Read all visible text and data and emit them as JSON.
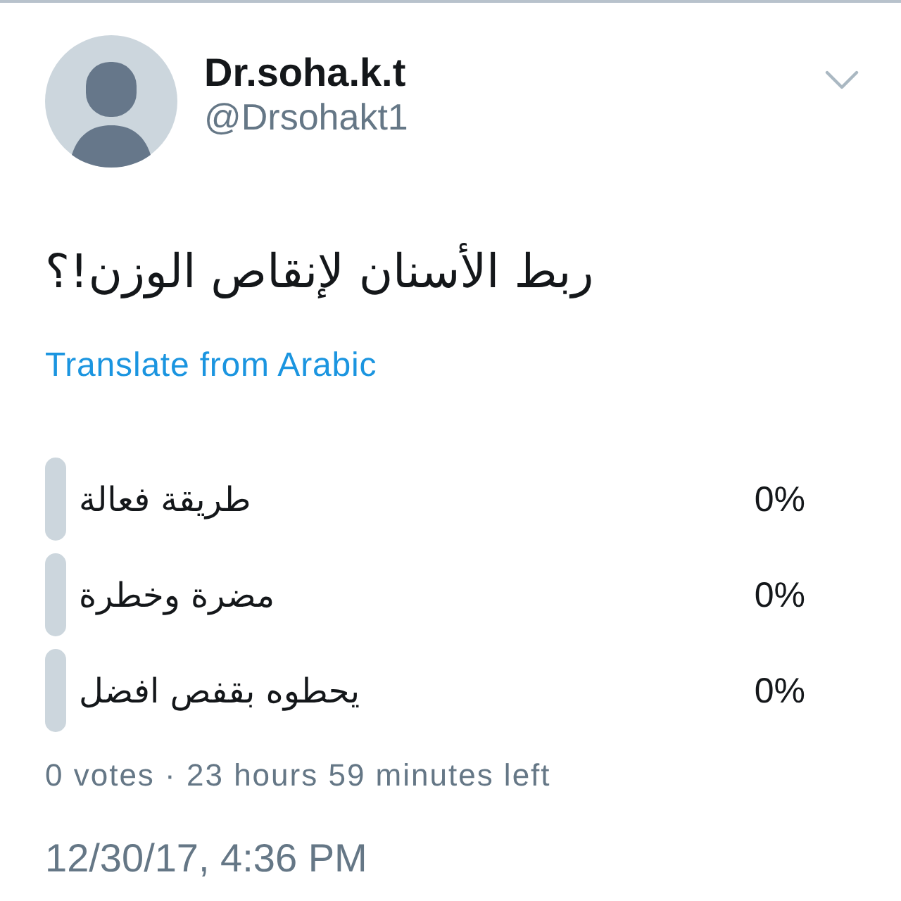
{
  "author": {
    "name": "Dr.soha.k.t",
    "handle": "@Drsohakt1"
  },
  "tweet": {
    "text": "ربط الأسنان لإنقاص الوزن!؟",
    "translate_link": "Translate from Arabic"
  },
  "poll": {
    "choices": [
      {
        "label": "طريقة فعالة",
        "percent": "0%",
        "level": 0
      },
      {
        "label": "مضرة وخطرة",
        "percent": "0%",
        "level": 0
      },
      {
        "label": "يحطوه بقفص افضل",
        "percent": "0%",
        "level": 0
      }
    ],
    "summary": "0 votes · 23 hours 59 minutes left"
  },
  "timestamp": "12/30/17, 4:36 PM"
}
